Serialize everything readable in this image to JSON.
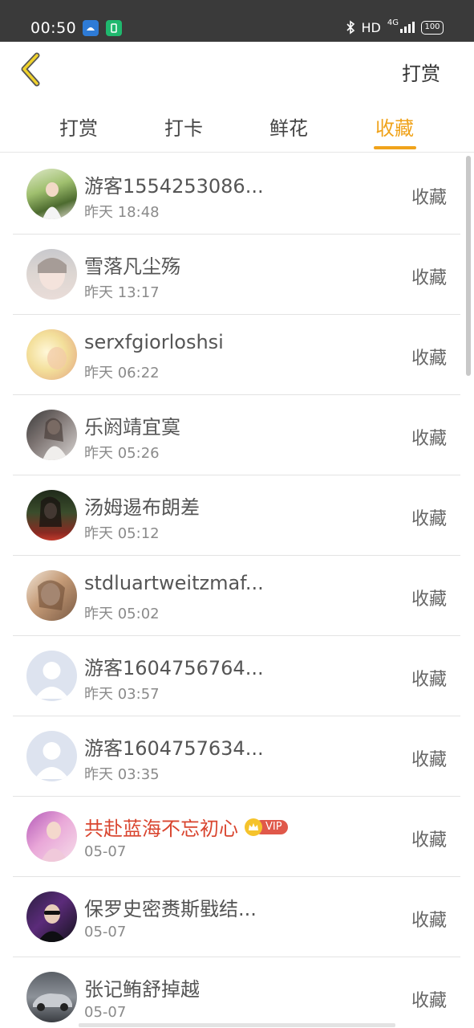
{
  "status_bar": {
    "time": "00:50",
    "network": "HD",
    "signal": "4G",
    "battery": "100"
  },
  "header": {
    "action_label": "打赏"
  },
  "tabs": [
    {
      "label": "打赏",
      "active": false
    },
    {
      "label": "打卡",
      "active": false
    },
    {
      "label": "鲜花",
      "active": false
    },
    {
      "label": "收藏",
      "active": true
    }
  ],
  "list": [
    {
      "name": "游客1554253086...",
      "time": "昨天 18:48",
      "action": "收藏",
      "avatar": "photo"
    },
    {
      "name": "雪落凡尘殇",
      "time": "昨天 13:17",
      "action": "收藏",
      "avatar": "photo"
    },
    {
      "name": "serxfgiorloshsi",
      "time": "昨天 06:22",
      "action": "收藏",
      "avatar": "photo"
    },
    {
      "name": "乐阏靖宜寞",
      "time": "昨天 05:26",
      "action": "收藏",
      "avatar": "photo"
    },
    {
      "name": "汤姆逷布朗差",
      "time": "昨天 05:12",
      "action": "收藏",
      "avatar": "photo"
    },
    {
      "name": "stdluartweitzmaf...",
      "time": "昨天 05:02",
      "action": "收藏",
      "avatar": "photo"
    },
    {
      "name": "游客1604756764...",
      "time": "昨天 03:57",
      "action": "收藏",
      "avatar": "default"
    },
    {
      "name": "游客1604757634...",
      "time": "昨天 03:35",
      "action": "收藏",
      "avatar": "default"
    },
    {
      "name": "共赴蓝海不忘初心",
      "time": "05-07",
      "action": "收藏",
      "avatar": "photo",
      "vip": "VIP"
    },
    {
      "name": "保罗史密赉斯戥结...",
      "time": "05-07",
      "action": "收藏",
      "avatar": "photo"
    },
    {
      "name": "张记鲔舒掉越",
      "time": "05-07",
      "action": "收藏",
      "avatar": "photo"
    }
  ],
  "colors": {
    "accent": "#f0a31b",
    "vip_name": "#d9452f",
    "status_bar": "#3a3a3a"
  }
}
